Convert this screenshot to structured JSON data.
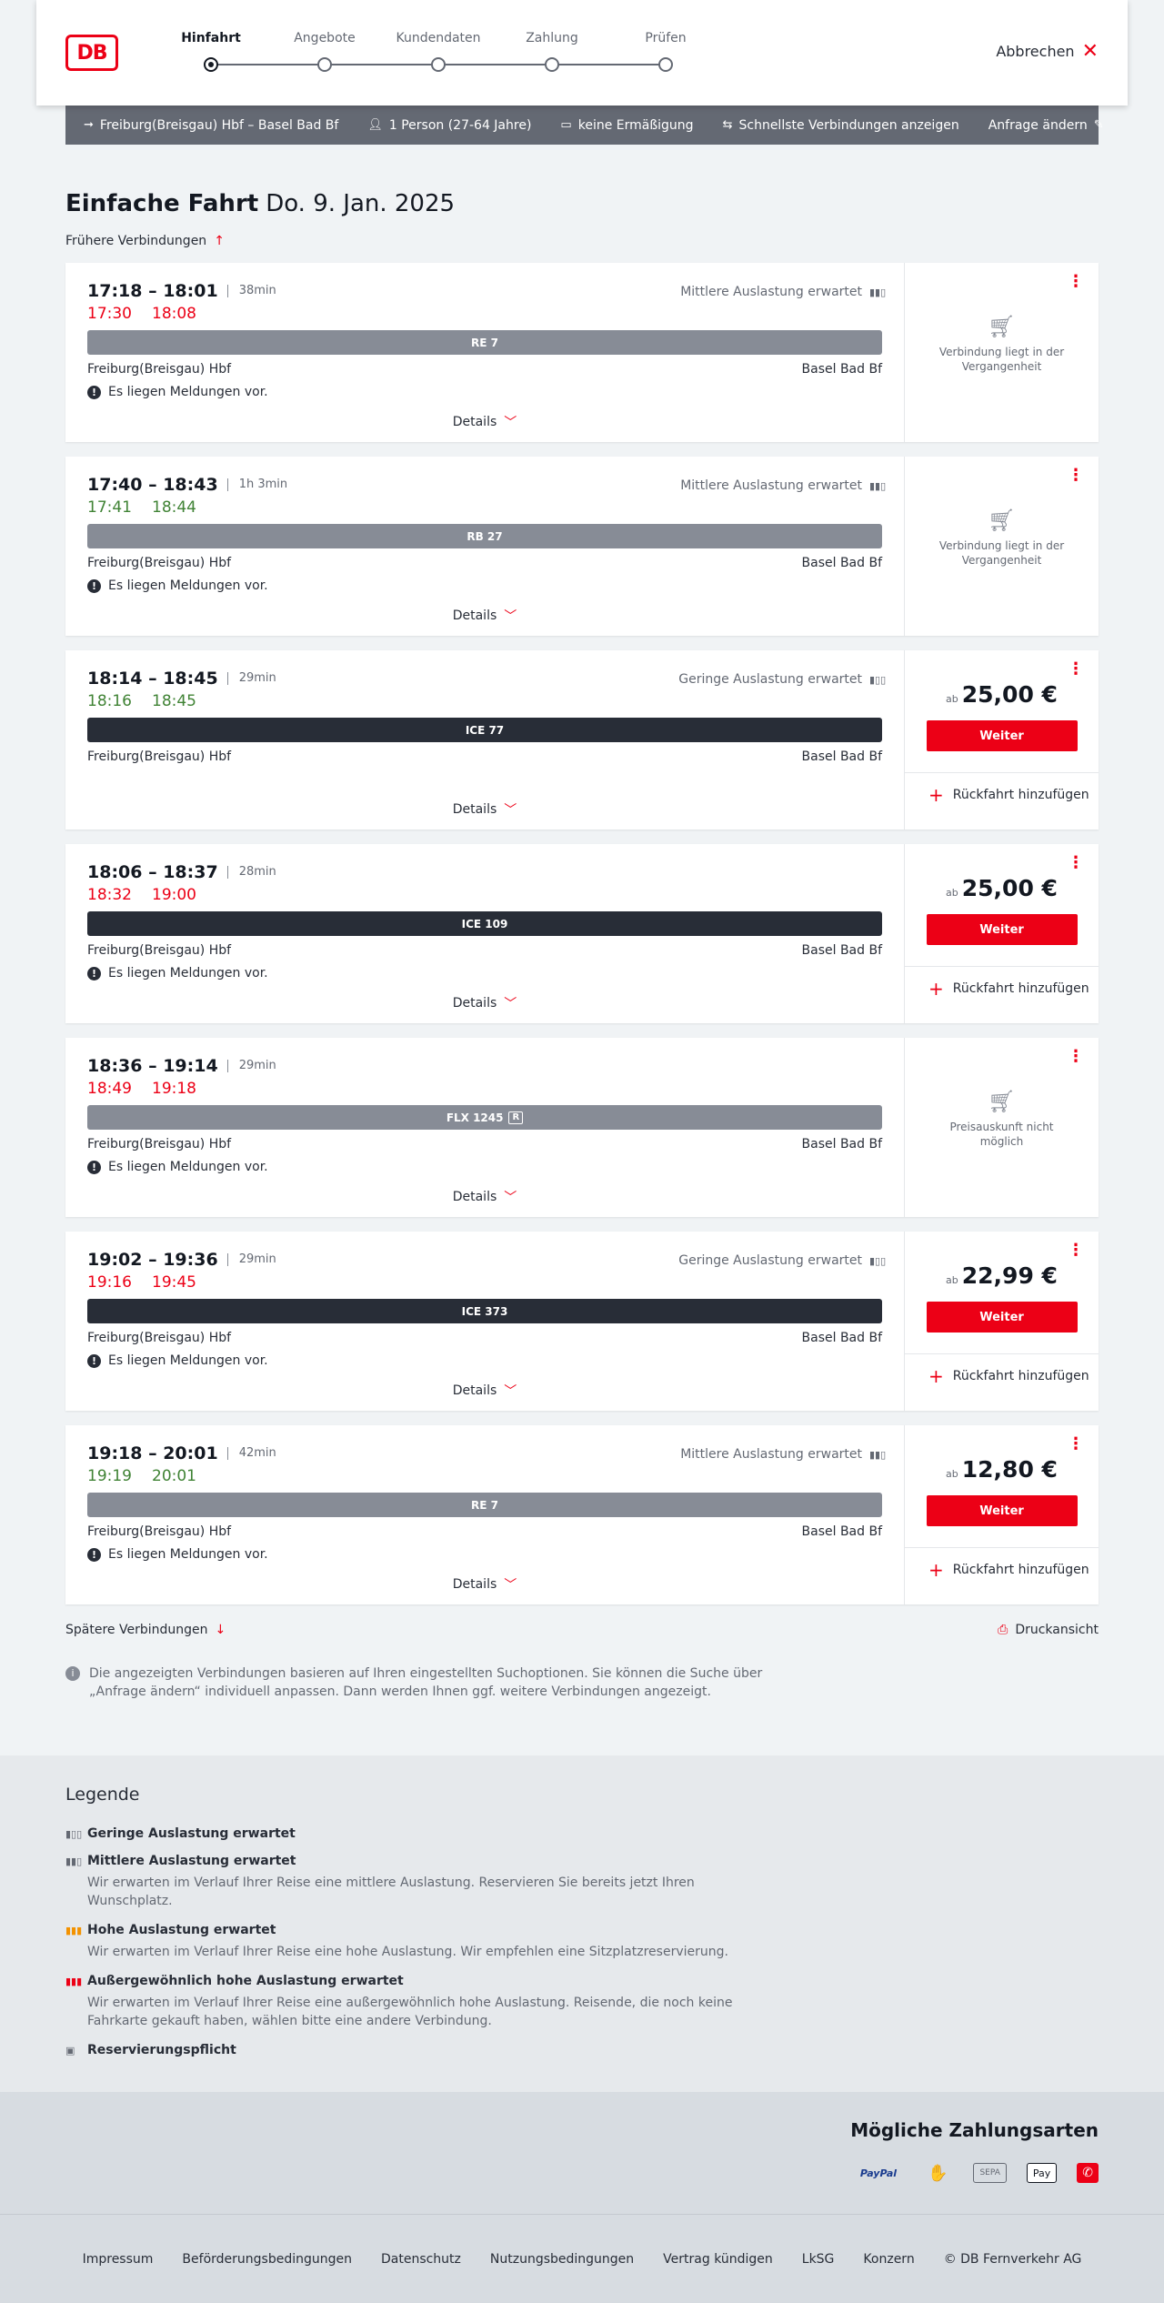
{
  "header": {
    "logo_text": "DB",
    "steps": [
      {
        "label": "Hinfahrt",
        "active": true
      },
      {
        "label": "Angebote",
        "active": false
      },
      {
        "label": "Kundendaten",
        "active": false
      },
      {
        "label": "Zahlung",
        "active": false
      },
      {
        "label": "Prüfen",
        "active": false
      }
    ],
    "cancel_label": "Abbrechen"
  },
  "query": {
    "route": "Freiburg(Breisgau) Hbf – Basel Bad Bf",
    "travelers": "1 Person (27-64 Jahre)",
    "discount": "keine Ermäßigung",
    "fastest": "Schnellste Verbindungen anzeigen",
    "edit_label": "Anfrage ändern"
  },
  "title": {
    "main": "Einfache Fahrt",
    "date": "Do. 9. Jan. 2025"
  },
  "earlier_label": "Frühere Verbindungen",
  "later_label": "Spätere Verbindungen",
  "print_label": "Druckansicht",
  "details_label": "Details",
  "return_label": "Rückfahrt hinzufügen",
  "continue_label": "Weiter",
  "price_prefix": "ab",
  "connections": [
    {
      "times": "17:18 – 18:01",
      "duration": "38min",
      "load": "Mittlere Auslastung erwartet",
      "rt_dep": "17:30",
      "rt_arr": "18:08",
      "late": true,
      "train": "RE 7",
      "train_style": "gray",
      "reservation": false,
      "from": "Freiburg(Breisgau) Hbf",
      "to": "Basel Bad Bf",
      "message": "Es liegen Meldungen vor.",
      "status": "past",
      "status_text": "Verbindung liegt in der Vergangenheit",
      "price": ""
    },
    {
      "times": "17:40 – 18:43",
      "duration": "1h 3min",
      "load": "Mittlere Auslastung erwartet",
      "rt_dep": "17:41",
      "rt_arr": "18:44",
      "late": false,
      "train": "RB 27",
      "train_style": "gray",
      "reservation": false,
      "from": "Freiburg(Breisgau) Hbf",
      "to": "Basel Bad Bf",
      "message": "Es liegen Meldungen vor.",
      "status": "past",
      "status_text": "Verbindung liegt in der Vergangenheit",
      "price": ""
    },
    {
      "times": "18:14 – 18:45",
      "duration": "29min",
      "load": "Geringe Auslastung erwartet",
      "rt_dep": "18:16",
      "rt_arr": "18:45",
      "late": false,
      "train": "ICE 77",
      "train_style": "dark",
      "reservation": false,
      "from": "Freiburg(Breisgau) Hbf",
      "to": "Basel Bad Bf",
      "message": "",
      "status": "price",
      "status_text": "",
      "price": "25,00 €"
    },
    {
      "times": "18:06 – 18:37",
      "duration": "28min",
      "load": "",
      "rt_dep": "18:32",
      "rt_arr": "19:00",
      "late": true,
      "train": "ICE 109",
      "train_style": "dark",
      "reservation": false,
      "from": "Freiburg(Breisgau) Hbf",
      "to": "Basel Bad Bf",
      "message": "Es liegen Meldungen vor.",
      "status": "price",
      "status_text": "",
      "price": "25,00 €"
    },
    {
      "times": "18:36 – 19:14",
      "duration": "29min",
      "load": "",
      "rt_dep": "18:49",
      "rt_arr": "19:18",
      "late": true,
      "train": "FLX 1245",
      "train_style": "gray",
      "reservation": true,
      "from": "Freiburg(Breisgau) Hbf",
      "to": "Basel Bad Bf",
      "message": "Es liegen Meldungen vor.",
      "status": "past",
      "status_text": "Preisauskunft nicht möglich",
      "price": ""
    },
    {
      "times": "19:02 – 19:36",
      "duration": "29min",
      "load": "Geringe Auslastung erwartet",
      "rt_dep": "19:16",
      "rt_arr": "19:45",
      "late": true,
      "train": "ICE 373",
      "train_style": "dark",
      "reservation": false,
      "from": "Freiburg(Breisgau) Hbf",
      "to": "Basel Bad Bf",
      "message": "Es liegen Meldungen vor.",
      "status": "price",
      "status_text": "",
      "price": "22,99 €"
    },
    {
      "times": "19:18 – 20:01",
      "duration": "42min",
      "load": "Mittlere Auslastung erwartet",
      "rt_dep": "19:19",
      "rt_arr": "20:01",
      "late": false,
      "train": "RE 7",
      "train_style": "gray",
      "reservation": false,
      "from": "Freiburg(Breisgau) Hbf",
      "to": "Basel Bad Bf",
      "message": "Es liegen Meldungen vor.",
      "status": "price",
      "status_text": "",
      "price": "12,80 €"
    }
  ],
  "info_text": "Die angezeigten Verbindungen basieren auf Ihren eingestellten Suchoptionen. Sie können die Suche über „Anfrage ändern“ individuell anpassen. Dann werden Ihnen ggf. weitere Verbindungen angezeigt.",
  "legend": {
    "title": "Legende",
    "items": [
      {
        "icon": "occupancy-low-icon",
        "title": "Geringe Auslastung erwartet",
        "desc": ""
      },
      {
        "icon": "occupancy-medium-icon",
        "title": "Mittlere Auslastung erwartet",
        "desc": "Wir erwarten im Verlauf Ihrer Reise eine mittlere Auslastung. Reservieren Sie bereits jetzt Ihren Wunschplatz."
      },
      {
        "icon": "occupancy-high-icon",
        "title": "Hohe Auslastung erwartet",
        "desc": "Wir erwarten im Verlauf Ihrer Reise eine hohe Auslastung. Wir empfehlen eine Sitzplatzreservierung."
      },
      {
        "icon": "occupancy-exceptional-icon",
        "title": "Außergewöhnlich hohe Auslastung erwartet",
        "desc": "Wir erwarten im Verlauf Ihrer Reise eine außergewöhnlich hohe Auslastung. Reisende, die noch keine Fahrkarte gekauft haben, wählen bitte eine andere Verbindung."
      },
      {
        "icon": "reservation-required-icon",
        "title": "Reservierungspflicht",
        "desc": ""
      }
    ]
  },
  "payment": {
    "title": "Mögliche Zahlungsarten",
    "methods": [
      "PayPal",
      "",
      "SEPA",
      "Pay",
      ""
    ]
  },
  "footer": {
    "links": [
      "Impressum",
      "Beförderungsbedingungen",
      "Datenschutz",
      "Nutzungsbedingungen",
      "Vertrag kündigen",
      "LkSG",
      "Konzern",
      "© DB Fernverkehr AG"
    ]
  }
}
